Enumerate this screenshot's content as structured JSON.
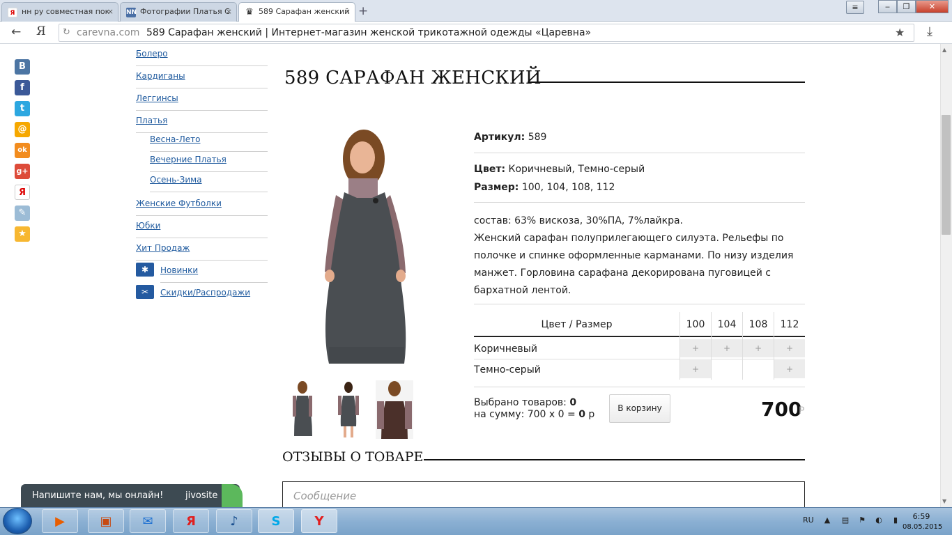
{
  "browser": {
    "tabs": [
      {
        "label": "нн ру совместная пок",
        "icon": "Я"
      },
      {
        "label": "Фотографии Платья С",
        "icon": "NN"
      },
      {
        "label": "589 Сарафан женский",
        "icon": "crown"
      }
    ],
    "url_domain": "carevna.com",
    "url_title": "589 Сарафан женский | Интернет-магазин женской трикотажной одежды «Царевна»"
  },
  "sidebar": {
    "items": [
      {
        "label": "Болеро"
      },
      {
        "label": "Кардиганы"
      },
      {
        "label": "Леггинсы"
      },
      {
        "label": "Платья"
      },
      {
        "label": "Весна-Лето"
      },
      {
        "label": "Вечерние Платья"
      },
      {
        "label": "Осень-Зима"
      },
      {
        "label": "Женские Футболки"
      },
      {
        "label": "Юбки"
      },
      {
        "label": "Хит Продаж"
      },
      {
        "label": "Новинки"
      },
      {
        "label": "Скидки/Распродажи"
      }
    ]
  },
  "social": [
    "В",
    "f",
    "t",
    "@",
    "ok",
    "g+",
    "Я",
    "✎",
    "★"
  ],
  "product": {
    "title": "589 САРАФАН ЖЕНСКИЙ",
    "article_label": "Артикул:",
    "article_value": "589",
    "color_label": "Цвет:",
    "color_value": "Коричневый, Темно-серый",
    "size_label": "Размер:",
    "size_value": "100, 104, 108, 112",
    "desc": [
      "состав: 63% вискоза,  30%ПА,  7%лайкра.",
      "Женский сарафан полуприлегающего силуэта. Рельефы по",
      "полочке и спинке  оформленные карманами. По низу изделия",
      "манжет. Горловина сарафана декорирована пуговицей с",
      "бархатной лентой."
    ],
    "grid": {
      "header": "Цвет / Размер",
      "sizes": [
        "100",
        "104",
        "108",
        "112"
      ],
      "rows": [
        {
          "name": "Коричневый",
          "avail": [
            true,
            true,
            true,
            true
          ]
        },
        {
          "name": "Темно-серый",
          "avail": [
            true,
            false,
            false,
            true
          ]
        }
      ],
      "plus": "+"
    },
    "selected_label": "Выбрано товаров:",
    "selected_count": "0",
    "sum_label": "на сумму: 700 x 0 =",
    "sum_value": "0",
    "sum_cur": "р",
    "cart_button": "В корзину",
    "price": "700",
    "price_cur": "Р"
  },
  "reviews": {
    "title": "ОТЗЫВЫ О ТОВАРЕ",
    "placeholder": "Сообщение"
  },
  "chat": {
    "text": "Напишите нам, мы онлайн!",
    "brand": "jivosite"
  },
  "taskbar": {
    "lang": "RU",
    "time": "6:59",
    "date": "08.05.2015"
  },
  "colors": {
    "link": "#1f5a9e",
    "accent": "#245aa0",
    "chat_bg": "#3d4a52",
    "chat_green": "#5cb85c"
  }
}
